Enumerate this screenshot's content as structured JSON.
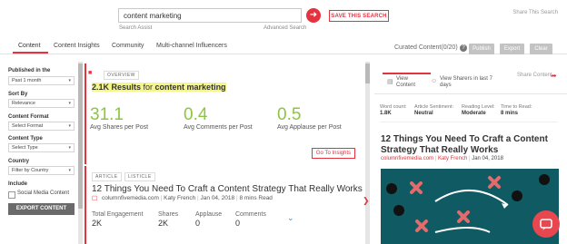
{
  "search": {
    "query": "content marketing",
    "assist_link": "Search Assist",
    "advanced_link": "Advanced Search",
    "save_label": "SAVE THIS SEARCH",
    "share_label": "Share This Search"
  },
  "tabs": [
    "Content",
    "Content Insights",
    "Community",
    "Multi-channel Influencers"
  ],
  "curated": {
    "label": "Curated Content(0/20)",
    "buttons": [
      "Publish",
      "Export",
      "Clear"
    ]
  },
  "sidebar": {
    "published_label": "Published in the",
    "published_value": "Past 1 month",
    "sort_label": "Sort By",
    "sort_value": "Relevance",
    "format_label": "Content Format",
    "format_value": "Select Format",
    "type_label": "Content Type",
    "type_value": "Select Type",
    "country_label": "Country",
    "country_value": "Filter by Country",
    "include_label": "Include",
    "social_label": "Social Media Content",
    "export_label": "EXPORT CONTENT"
  },
  "overview": {
    "tag": "OVERVIEW",
    "count": "2.1K Results",
    "for_text": " for ",
    "topic": "content marketing",
    "stats": [
      {
        "value": "31.1",
        "label": "Avg Shares per Post"
      },
      {
        "value": "0.4",
        "label": "Avg Comments per Post"
      },
      {
        "value": "0.5",
        "label": "Avg Applause per Post"
      }
    ],
    "goto_label": "Go To Insights"
  },
  "article": {
    "tags": [
      "ARTICLE",
      "LISTICLE"
    ],
    "title": "12 Things You Need To Craft a Content Strategy That Really Works",
    "source": "columnfivemedia.com",
    "author": "Katy French",
    "date": "Jan 04, 2018",
    "read_time": "8 mins Read",
    "metrics": [
      {
        "label": "Total Engagement",
        "value": "2K"
      },
      {
        "label": "Shares",
        "value": "2K"
      },
      {
        "label": "Applause",
        "value": "0"
      },
      {
        "label": "Comments",
        "value": "0"
      }
    ]
  },
  "right_panel": {
    "tab_view": "View Content",
    "tab_sharers": "View Sharers in last 7 days",
    "share_content": "Share Content",
    "stats": [
      {
        "label": "Word count:",
        "value": "1.8K"
      },
      {
        "label": "Article Sentiment:",
        "value": "Neutral"
      },
      {
        "label": "Reading Level:",
        "value": "Moderate"
      },
      {
        "label": "Time to Read:",
        "value": "8 mins"
      }
    ],
    "title": "12 Things You Need To Craft a Content Strategy That Really Works",
    "source": "columnfivemedia.com",
    "author": "Katy French",
    "date": "Jan 04, 2018"
  },
  "colors": {
    "accent": "#e5323f",
    "stat_green": "#8cc63f",
    "highlight": "#f4f58a",
    "image_bg": "#0f5a63"
  }
}
